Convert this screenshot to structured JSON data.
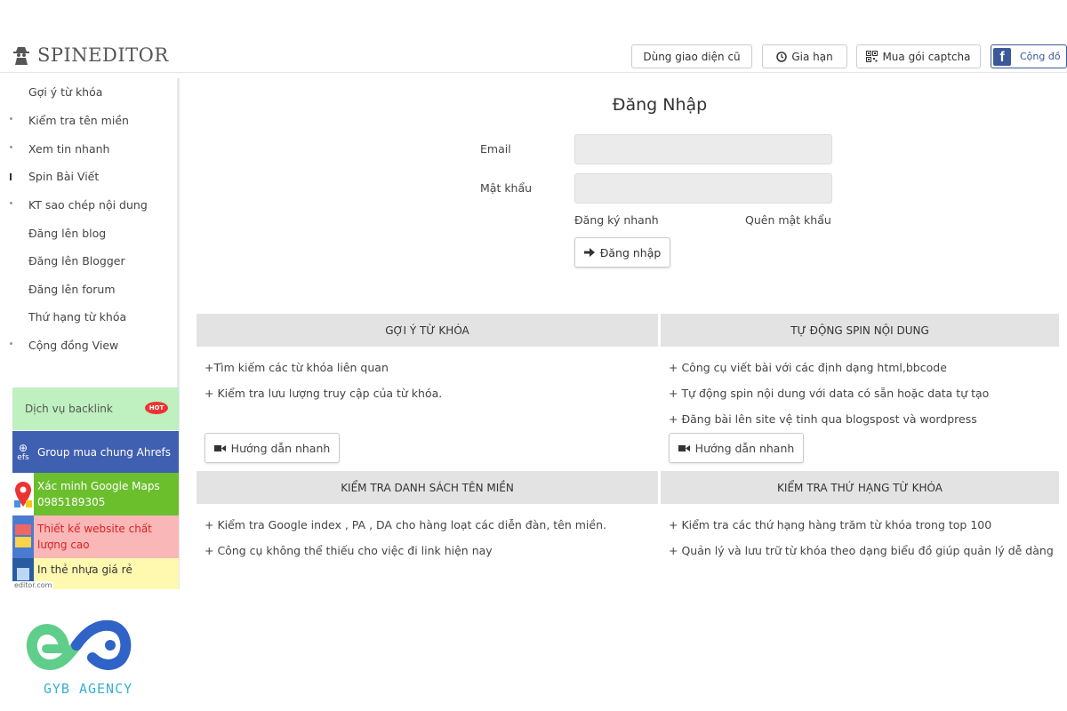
{
  "header": {
    "brand": "SPINEDITOR",
    "buttons": {
      "old_ui": "Dùng giao diện cũ",
      "renew": "Gia hạn",
      "captcha": "Mua gói captcha",
      "community": "Cộng đồ"
    }
  },
  "sidebar": {
    "items": [
      "Gợi ý từ khóa",
      "Kiểm tra tên miền",
      "Xem tin nhanh",
      "Spin Bài Viết",
      "KT sao chép nội dung",
      "Đăng lên blog",
      "Đăng lên Blogger",
      "Đăng lên forum",
      "Thứ hạng từ khóa",
      "Cộng đồng View"
    ],
    "promos": {
      "backlink": "Dịch vụ backlink",
      "backlink_badge": "HOT",
      "ahrefs": "Group mua chung Ahrefs",
      "ahrefs_side": "efs",
      "maps_line1": "Xác minh Google Maps",
      "maps_line2": "0985189305",
      "web_line1": "Thiết kế website chất",
      "web_line2": "lượng cao",
      "card": "In thẻ nhựa giá rẻ"
    },
    "url_fragment": "editor.com"
  },
  "login": {
    "title": "Đăng Nhập",
    "email_label": "Email",
    "password_label": "Mật khẩu",
    "email_value": "",
    "password_value": "",
    "register_link": "Đăng ký nhanh",
    "forgot_link": "Quên mật khẩu",
    "submit": "Đăng nhập"
  },
  "features": {
    "keyword": {
      "title": "GỢI Ý TỪ KHÓA",
      "bullets": [
        "+Tìm kiếm các từ khóa liên quan",
        "+ Kiểm tra lưu lượng truy cập của từ khóa."
      ],
      "guide": "Hướng dẫn nhanh"
    },
    "spin": {
      "title": "TỰ ĐỘNG SPIN NỘI DUNG",
      "bullets": [
        "+ Công cụ viết bài với các định dạng html,bbcode",
        "+ Tự động spin nội dung với data có sẵn hoặc data tự tạo",
        "+ Đăng bài lên site vệ tinh qua blogspost và wordpress"
      ],
      "guide": "Hướng dẫn nhanh"
    },
    "domain": {
      "title": "KIỂM TRA DANH SÁCH TÊN MIỀN",
      "bullets": [
        "+ Kiểm tra Google index , PA , DA cho hàng loạt các diễn đàn, tên miền.",
        "+ Công cụ không thể thiếu cho việc đi link hiện nay"
      ]
    },
    "rank": {
      "title": "KIỂM TRA THỨ HẠNG TỪ KHÓA",
      "bullets": [
        "+ Kiểm tra các thứ hạng hàng trăm từ khóa trong top 100",
        "+ Quản lý và lưu trữ từ khóa theo dạng biểu đồ giúp quản lý dễ dàng"
      ]
    }
  },
  "agency": {
    "name": "GYB AGENCY"
  },
  "colors": {
    "facebook": "#3b5998",
    "section_bg": "#e3e3e3",
    "promo_backlink": "#bff0bf",
    "promo_ahrefs": "#3f5fb0",
    "promo_maps": "#6bbf2d",
    "promo_web": "#f9b7b7",
    "promo_card": "#fff9b0",
    "agency_blue": "#2f63c8",
    "agency_green": "#5fce8a"
  }
}
